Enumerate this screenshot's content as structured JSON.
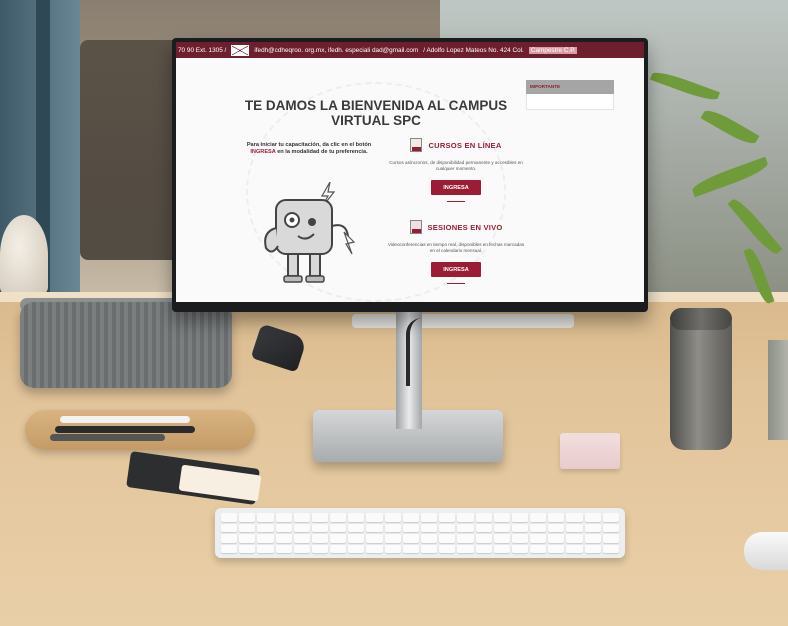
{
  "topbar": {
    "phone_fragment": "70 90 Ext. 1305 /",
    "emails": "ifedh@cdheqroo. org.mx, ifedh. especiali dad@gmail.com",
    "address_prefix": "/ Adolfo Lopez Mateos No. 424 Col.",
    "address_highlight": "Campestre C.P."
  },
  "main": {
    "title": "TE DAMOS LA BIENVENIDA AL CAMPUS VIRTUAL SPC",
    "intro_before": "Para iniciar tu capacitación, da clic en el botón",
    "intro_highlight": "INGRESA",
    "intro_after": "en la modalidad de tu preferencia."
  },
  "courses": [
    {
      "title": "CURSOS EN LÍNEA",
      "description": "Cursos asíncronos, de disponibilidad permanente y accesibles en cualquier momento.",
      "button": "INGRESA"
    },
    {
      "title": "SESIONES EN VIVO",
      "description": "Videoconferencias en tiempo real, disponibles en fechas marcadas en el calendario mensual.",
      "button": "INGRESA"
    }
  ],
  "sidebar": {
    "heading": "IMPORTANTE"
  },
  "colors": {
    "brand": "#9b1d33",
    "topbar": "#6e1f2d"
  },
  "icons": [
    "mail-icon",
    "course-icon",
    "video-icon",
    "mascot-icon"
  ]
}
